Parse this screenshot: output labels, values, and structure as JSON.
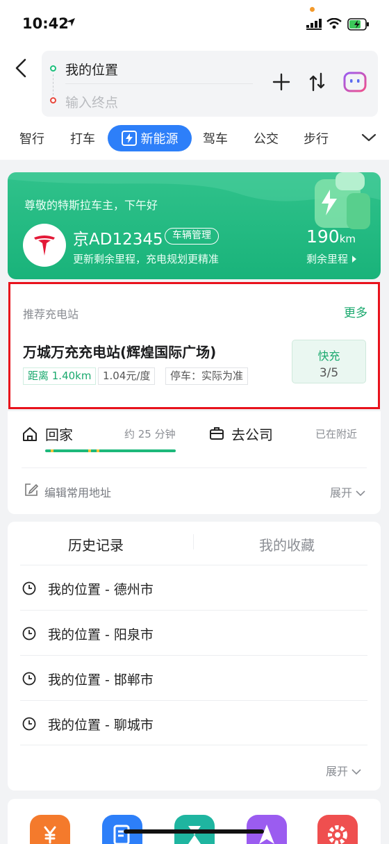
{
  "status_bar": {
    "time": "10:42"
  },
  "search": {
    "start": "我的位置",
    "end_placeholder": "输入终点"
  },
  "tabs": {
    "items": [
      "智行",
      "打车",
      "新能源",
      "驾车",
      "公交",
      "步行"
    ],
    "active": "新能源"
  },
  "ev_card": {
    "greeting": "尊敬的特斯拉车主，下午好",
    "plate": "京AD12345",
    "manage_label": "车辆管理",
    "hint": "更新剩余里程，充电规划更精准",
    "range_value": "190",
    "range_unit": "km",
    "range_label": "剩余里程",
    "accent": "#1fb57c"
  },
  "recommended": {
    "title": "推荐充电站",
    "more": "更多",
    "name": "万城万充充电站(辉煌国际广场)",
    "distance": "距离 1.40km",
    "price": "1.04元/度",
    "parking": "停车：实际为准",
    "fast_label": "快充",
    "fast_value": "3/5",
    "highlight_color": "#e8121c"
  },
  "common": {
    "home_label": "回家",
    "home_time": "约 25 分钟",
    "work_label": "去公司",
    "work_status": "已在附近",
    "edit_label": "编辑常用地址",
    "expand_label": "展开"
  },
  "history": {
    "tab_history": "历史记录",
    "tab_favorites": "我的收藏",
    "items": [
      "我的位置 - 德州市",
      "我的位置 - 阳泉市",
      "我的位置 - 邯郸市",
      "我的位置 - 聊城市"
    ],
    "expand_label": "展开"
  },
  "shortcuts": {
    "icons": [
      "yuan-icon",
      "document-icon",
      "hourglass-icon",
      "navigation-icon",
      "gear-icon"
    ],
    "colors": [
      "#f47a2c",
      "#2d7ff9",
      "#1fb5a0",
      "#9b5cf0",
      "#ef4f4f"
    ]
  }
}
